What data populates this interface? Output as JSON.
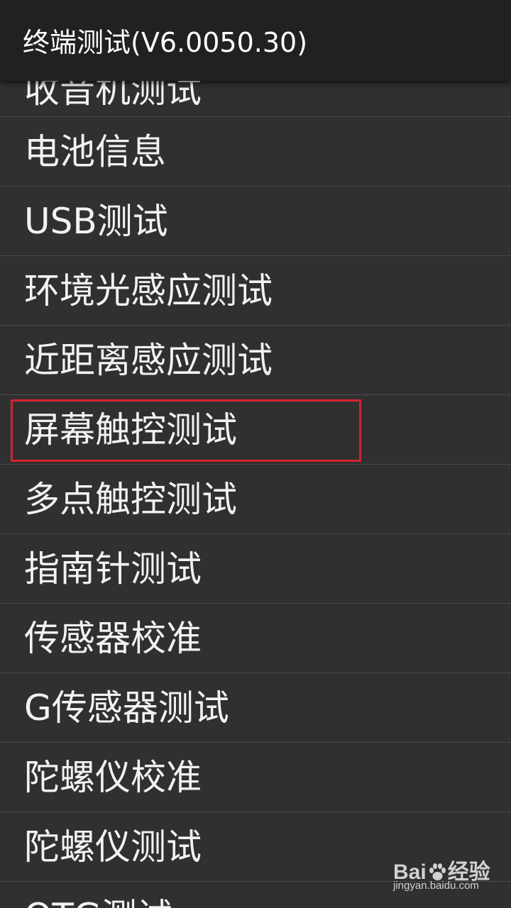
{
  "app": {
    "title": "终端测试(V6.0050.30)"
  },
  "menu": {
    "items": [
      {
        "label": "收音机测试"
      },
      {
        "label": "电池信息"
      },
      {
        "label": "USB测试"
      },
      {
        "label": "环境光感应测试"
      },
      {
        "label": "近距离感应测试"
      },
      {
        "label": "屏幕触控测试"
      },
      {
        "label": "多点触控测试"
      },
      {
        "label": "指南针测试"
      },
      {
        "label": "传感器校准"
      },
      {
        "label": "G传感器测试"
      },
      {
        "label": "陀螺仪校准"
      },
      {
        "label": "陀螺仪测试"
      },
      {
        "label": "OTG测试"
      }
    ],
    "highlighted_item": "屏幕触控测试"
  },
  "colors": {
    "background": "#303030",
    "titlebar": "#212121",
    "divider": "#4a4a4a",
    "highlight_border": "#d32430",
    "text": "#f2f2f2"
  },
  "watermark": {
    "logo": "Bai 经验",
    "url": "jingyan.baidu.com"
  }
}
